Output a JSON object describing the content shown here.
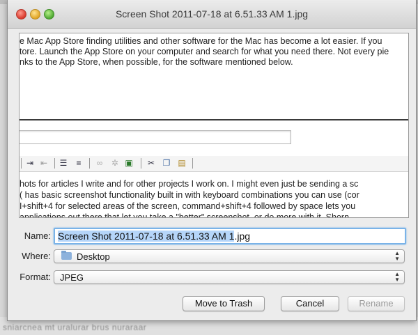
{
  "window": {
    "title": "Screen Shot 2011-07-18 at 6.51.33 AM 1.jpg"
  },
  "preview": {
    "top_lines": [
      "e Mac App Store finding utilities and other software for the Mac has become a lot easier. If you",
      "tore. Launch the App Store on your computer and search for what you need there. Not every pie",
      "nks to the App Store, when possible, for the software mentioned below."
    ],
    "body_lines": [
      "hots for articles I write and for other projects I work on. I might even just be sending a sc",
      "( has basic screenshot functionality built in with keyboard combinations you can use (cor",
      "I+shift+4 for selected areas of the screen, command+shift+4 followed by space lets you",
      "applications out there that let you take a \"better\" screenshot, or do more with it. Shorn"
    ]
  },
  "form": {
    "name_label": "Name:",
    "name_selected": "Screen Shot 2011-07-18 at 6.51.33 AM 1",
    "name_ext": ".jpg",
    "where_label": "Where:",
    "where_value": "Desktop",
    "format_label": "Format:",
    "format_value": "JPEG"
  },
  "buttons": {
    "move_to_trash": "Move to Trash",
    "cancel": "Cancel",
    "rename": "Rename"
  },
  "background": {
    "bottom_text": "sniarcnea mt uralurar brus nuraraar"
  },
  "icons": [
    "close-icon",
    "minimize-icon",
    "zoom-icon",
    "folder-icon",
    "popup-arrows-icon"
  ]
}
